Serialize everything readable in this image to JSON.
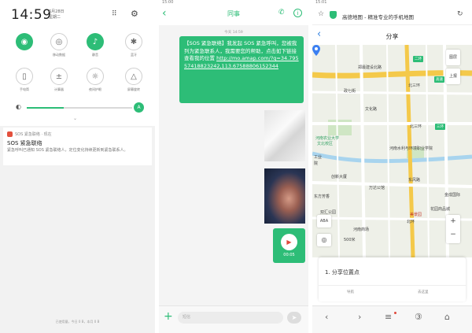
{
  "screen1": {
    "time": "14:59",
    "date_line1": "6月28日",
    "date_line2": "星期二",
    "tiles": [
      {
        "label": "",
        "icon": "wifi-icon",
        "on": true
      },
      {
        "label": "移动数据",
        "icon": "globe-icon",
        "on": false
      },
      {
        "label": "静音",
        "icon": "bell-icon",
        "on": true
      },
      {
        "label": "蓝牙",
        "icon": "bluetooth-icon",
        "on": false
      },
      {
        "label": "手电筒",
        "icon": "flashlight-icon",
        "on": false
      },
      {
        "label": "计算器",
        "icon": "calculator-icon",
        "on": false
      },
      {
        "label": "夜间护眼",
        "icon": "eye-care-icon",
        "on": false
      },
      {
        "label": "屏幕旋转",
        "icon": "rotate-icon",
        "on": false
      }
    ],
    "brightness": 0.35,
    "brightness_auto": "A",
    "notification": {
      "app": "SOS 紧急联络 · 现在",
      "title": "SOS 紧急联络",
      "body": "紧急呼叫已通知 SOS 紧急联络人，定位变化持续更新到紧急联系人。"
    },
    "footer": "已使用量，今日 0 B，本月 0 B"
  },
  "screen2": {
    "status": "15:00",
    "title": "同事",
    "timestamp": "今天 14:59",
    "message_text": "【SOS 紧急联络】我发起 SOS 紧急呼叫，您被我列为紧急联系人，我需要您的帮助，点击如下链接查看我的位置 ",
    "message_link": "http://mo.amap.com/?q=34.79557418823242,113.67588806152344",
    "voice_duration": "00:05",
    "input_placeholder": "短信"
  },
  "screen3": {
    "status": "15:01",
    "url_title": "高德地图 - 精准专业的手机地图",
    "page_title": "分享",
    "map_labels": [
      "郑最建设北路",
      "北三环",
      "高速",
      "二环",
      "三环",
      "北三环",
      "政七街",
      "文化路",
      "河南农业大学",
      "文北校区",
      "工业",
      "院",
      "东方芳香",
      "创新大厦",
      "河南水利与环境职业学院",
      "东风路",
      "万达公馆",
      "双汇公园",
      "河南商场",
      "金成国际",
      "美景园",
      "北环",
      "花园商品城"
    ],
    "scale_label": "500米",
    "panel_title": "1. 分享位置点",
    "panel_option1": "导航",
    "panel_option2": "去这里",
    "map_controls": {
      "layers": "图层",
      "report": "上报",
      "street": "ABA"
    }
  }
}
